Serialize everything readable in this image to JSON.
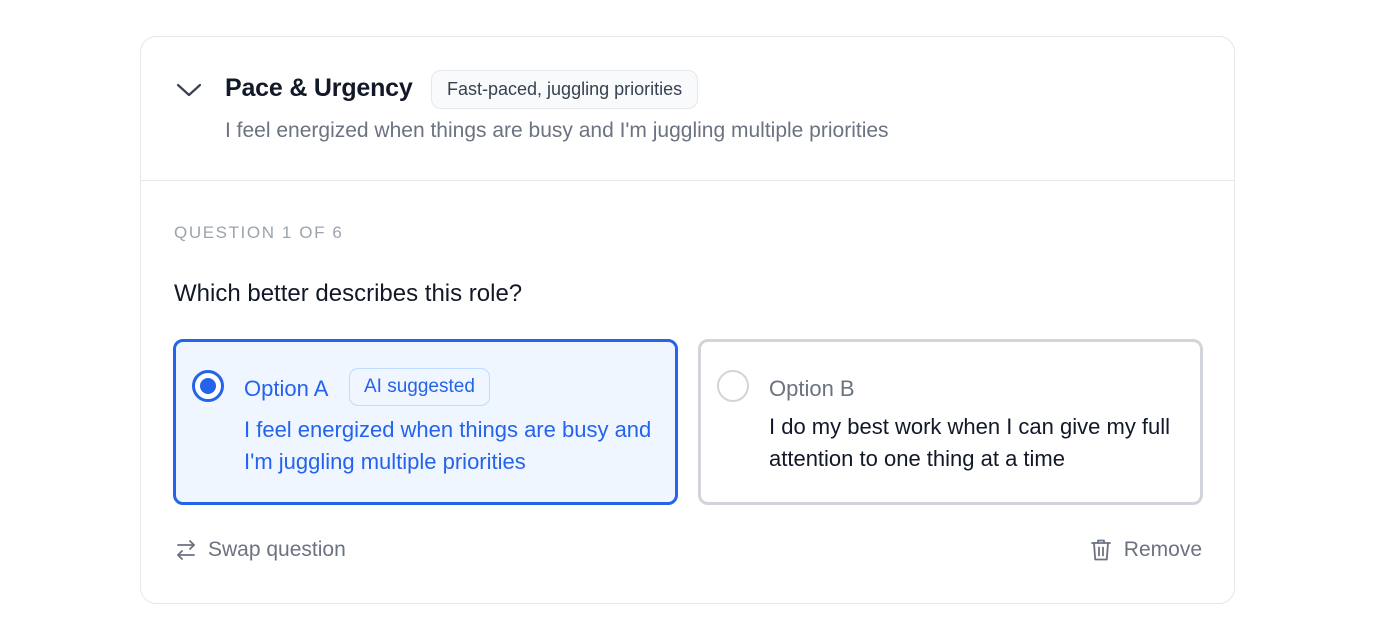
{
  "section": {
    "title": "Pace & Urgency",
    "badge": "Fast-paced, juggling priorities",
    "subtitle": "I feel energized when things are busy and I'm juggling multiple priorities",
    "collapse_icon": "chevron-down-icon"
  },
  "question": {
    "counter": "QUESTION 1 OF 6",
    "prompt": "Which better describes this role?",
    "options": [
      {
        "label": "Option A",
        "badge": "AI suggested",
        "text": "I feel energized when things are busy and I'm juggling multiple priorities",
        "selected": true
      },
      {
        "label": "Option B",
        "text": "I do my best work when I can give my full attention to one thing at a time",
        "selected": false
      }
    ]
  },
  "actions": {
    "swap_label": "Swap question",
    "swap_icon": "swap-arrows-icon",
    "remove_label": "Remove",
    "remove_icon": "trash-icon"
  },
  "colors": {
    "accent": "#2563eb",
    "selected_bg": "#eff6ff",
    "border": "#e5e7eb",
    "muted_text": "#6b7280"
  }
}
